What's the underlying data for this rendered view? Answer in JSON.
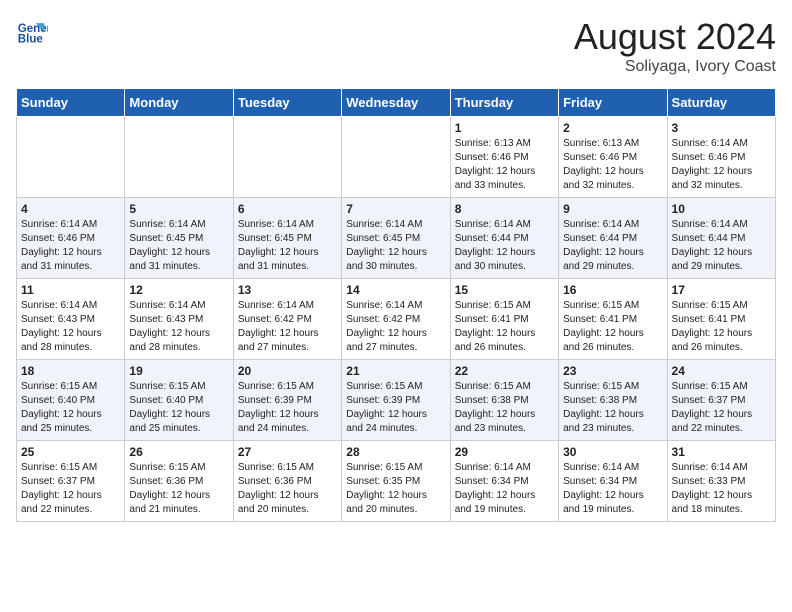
{
  "header": {
    "logo_line1": "General",
    "logo_line2": "Blue",
    "main_title": "August 2024",
    "subtitle": "Soliyaga, Ivory Coast"
  },
  "days_of_week": [
    "Sunday",
    "Monday",
    "Tuesday",
    "Wednesday",
    "Thursday",
    "Friday",
    "Saturday"
  ],
  "weeks": [
    [
      {
        "day": "",
        "info": ""
      },
      {
        "day": "",
        "info": ""
      },
      {
        "day": "",
        "info": ""
      },
      {
        "day": "",
        "info": ""
      },
      {
        "day": "1",
        "info": "Sunrise: 6:13 AM\nSunset: 6:46 PM\nDaylight: 12 hours\nand 33 minutes."
      },
      {
        "day": "2",
        "info": "Sunrise: 6:13 AM\nSunset: 6:46 PM\nDaylight: 12 hours\nand 32 minutes."
      },
      {
        "day": "3",
        "info": "Sunrise: 6:14 AM\nSunset: 6:46 PM\nDaylight: 12 hours\nand 32 minutes."
      }
    ],
    [
      {
        "day": "4",
        "info": "Sunrise: 6:14 AM\nSunset: 6:46 PM\nDaylight: 12 hours\nand 31 minutes."
      },
      {
        "day": "5",
        "info": "Sunrise: 6:14 AM\nSunset: 6:45 PM\nDaylight: 12 hours\nand 31 minutes."
      },
      {
        "day": "6",
        "info": "Sunrise: 6:14 AM\nSunset: 6:45 PM\nDaylight: 12 hours\nand 31 minutes."
      },
      {
        "day": "7",
        "info": "Sunrise: 6:14 AM\nSunset: 6:45 PM\nDaylight: 12 hours\nand 30 minutes."
      },
      {
        "day": "8",
        "info": "Sunrise: 6:14 AM\nSunset: 6:44 PM\nDaylight: 12 hours\nand 30 minutes."
      },
      {
        "day": "9",
        "info": "Sunrise: 6:14 AM\nSunset: 6:44 PM\nDaylight: 12 hours\nand 29 minutes."
      },
      {
        "day": "10",
        "info": "Sunrise: 6:14 AM\nSunset: 6:44 PM\nDaylight: 12 hours\nand 29 minutes."
      }
    ],
    [
      {
        "day": "11",
        "info": "Sunrise: 6:14 AM\nSunset: 6:43 PM\nDaylight: 12 hours\nand 28 minutes."
      },
      {
        "day": "12",
        "info": "Sunrise: 6:14 AM\nSunset: 6:43 PM\nDaylight: 12 hours\nand 28 minutes."
      },
      {
        "day": "13",
        "info": "Sunrise: 6:14 AM\nSunset: 6:42 PM\nDaylight: 12 hours\nand 27 minutes."
      },
      {
        "day": "14",
        "info": "Sunrise: 6:14 AM\nSunset: 6:42 PM\nDaylight: 12 hours\nand 27 minutes."
      },
      {
        "day": "15",
        "info": "Sunrise: 6:15 AM\nSunset: 6:41 PM\nDaylight: 12 hours\nand 26 minutes."
      },
      {
        "day": "16",
        "info": "Sunrise: 6:15 AM\nSunset: 6:41 PM\nDaylight: 12 hours\nand 26 minutes."
      },
      {
        "day": "17",
        "info": "Sunrise: 6:15 AM\nSunset: 6:41 PM\nDaylight: 12 hours\nand 26 minutes."
      }
    ],
    [
      {
        "day": "18",
        "info": "Sunrise: 6:15 AM\nSunset: 6:40 PM\nDaylight: 12 hours\nand 25 minutes."
      },
      {
        "day": "19",
        "info": "Sunrise: 6:15 AM\nSunset: 6:40 PM\nDaylight: 12 hours\nand 25 minutes."
      },
      {
        "day": "20",
        "info": "Sunrise: 6:15 AM\nSunset: 6:39 PM\nDaylight: 12 hours\nand 24 minutes."
      },
      {
        "day": "21",
        "info": "Sunrise: 6:15 AM\nSunset: 6:39 PM\nDaylight: 12 hours\nand 24 minutes."
      },
      {
        "day": "22",
        "info": "Sunrise: 6:15 AM\nSunset: 6:38 PM\nDaylight: 12 hours\nand 23 minutes."
      },
      {
        "day": "23",
        "info": "Sunrise: 6:15 AM\nSunset: 6:38 PM\nDaylight: 12 hours\nand 23 minutes."
      },
      {
        "day": "24",
        "info": "Sunrise: 6:15 AM\nSunset: 6:37 PM\nDaylight: 12 hours\nand 22 minutes."
      }
    ],
    [
      {
        "day": "25",
        "info": "Sunrise: 6:15 AM\nSunset: 6:37 PM\nDaylight: 12 hours\nand 22 minutes."
      },
      {
        "day": "26",
        "info": "Sunrise: 6:15 AM\nSunset: 6:36 PM\nDaylight: 12 hours\nand 21 minutes."
      },
      {
        "day": "27",
        "info": "Sunrise: 6:15 AM\nSunset: 6:36 PM\nDaylight: 12 hours\nand 20 minutes."
      },
      {
        "day": "28",
        "info": "Sunrise: 6:15 AM\nSunset: 6:35 PM\nDaylight: 12 hours\nand 20 minutes."
      },
      {
        "day": "29",
        "info": "Sunrise: 6:14 AM\nSunset: 6:34 PM\nDaylight: 12 hours\nand 19 minutes."
      },
      {
        "day": "30",
        "info": "Sunrise: 6:14 AM\nSunset: 6:34 PM\nDaylight: 12 hours\nand 19 minutes."
      },
      {
        "day": "31",
        "info": "Sunrise: 6:14 AM\nSunset: 6:33 PM\nDaylight: 12 hours\nand 18 minutes."
      }
    ]
  ]
}
